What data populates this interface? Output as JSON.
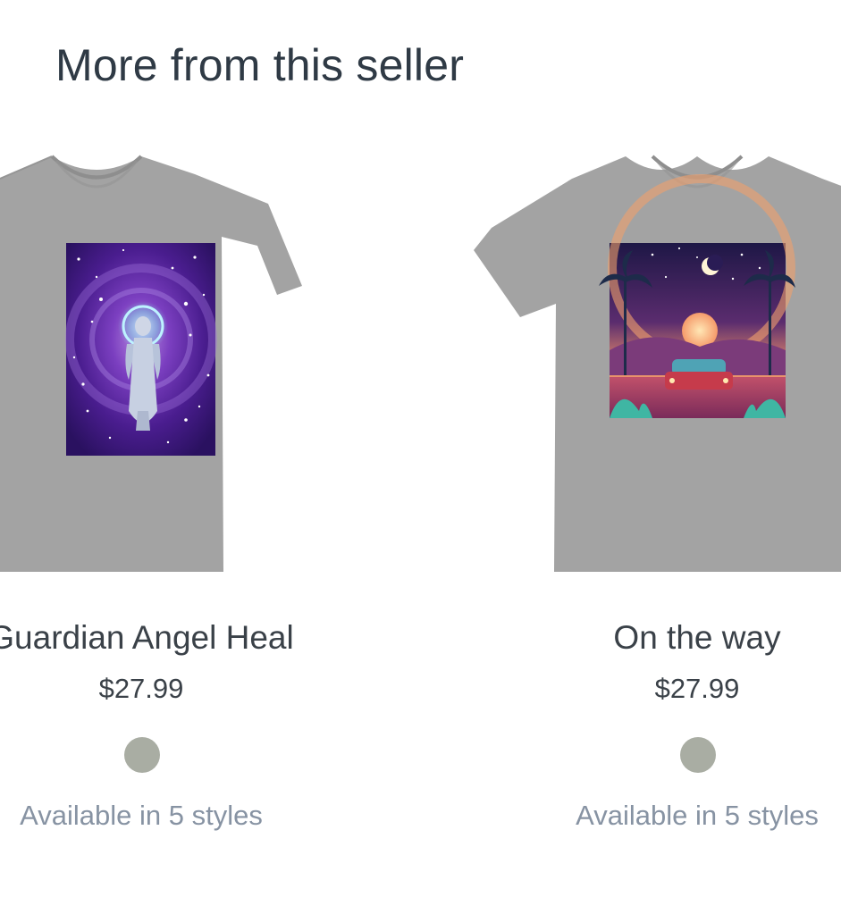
{
  "section": {
    "title": "More from this seller"
  },
  "products": [
    {
      "title": "Guardian Angel Heal",
      "price": "$27.99",
      "swatch_color": "#a9ada3",
      "styles_text": "Available in 5 styles",
      "shirt_color": "#a3a3a3",
      "design": "guardian-angel-galaxy"
    },
    {
      "title": "On the way",
      "price": "$27.99",
      "swatch_color": "#a9ada3",
      "styles_text": "Available in 5 styles",
      "shirt_color": "#a3a3a3",
      "design": "retro-car-sunset"
    }
  ]
}
